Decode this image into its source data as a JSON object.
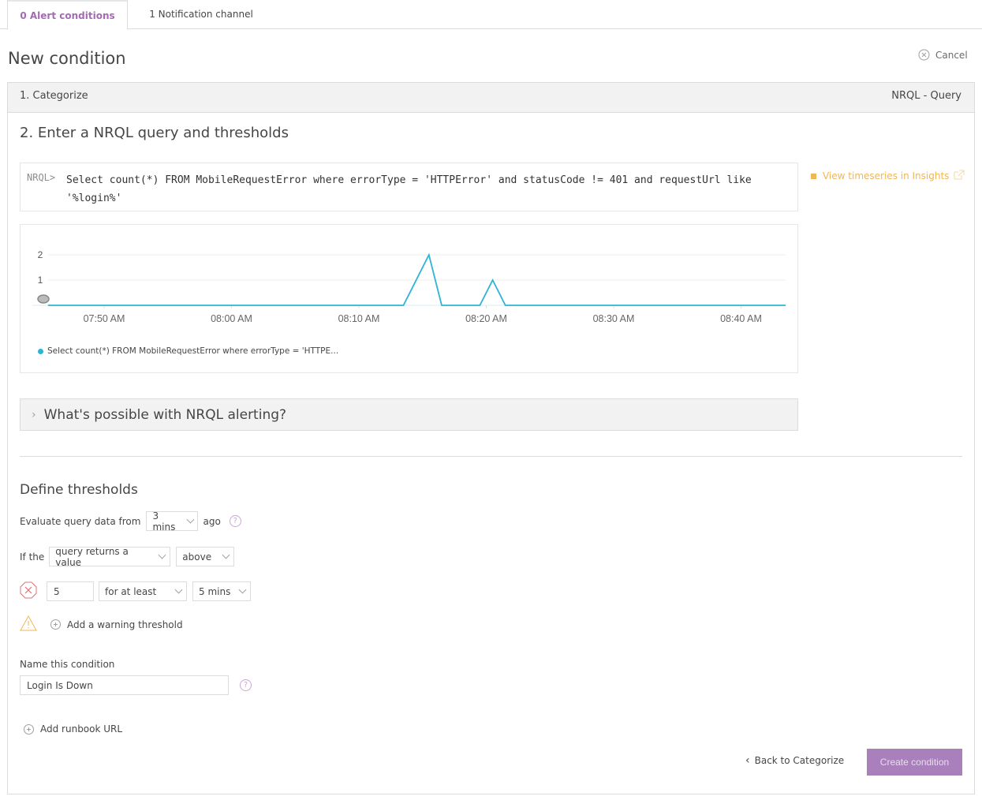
{
  "tabs": [
    {
      "label": "0 Alert conditions",
      "active": true
    },
    {
      "label": "1 Notification channel",
      "active": false
    }
  ],
  "page_title": "New condition",
  "cancel_label": "Cancel",
  "step1": {
    "label": "1. Categorize",
    "type": "NRQL - Query"
  },
  "step2": {
    "title": "2. Enter a NRQL query and thresholds",
    "prompt": "NRQL>",
    "query": "Select count(*) FROM MobileRequestError where errorType = 'HTTPError' and statusCode != 401 and requestUrl like\n'%login%'",
    "insights_link": "View timeseries in Insights"
  },
  "chart_data": {
    "type": "line",
    "title": "",
    "xlabel": "",
    "ylabel": "",
    "x_tick_labels": [
      "07:50 AM",
      "08:00 AM",
      "08:10 AM",
      "08:20 AM",
      "08:30 AM",
      "08:40 AM"
    ],
    "y_tick_labels": [
      "1",
      "2"
    ],
    "ylim": [
      0,
      2
    ],
    "xlim_minutes_from_0740": [
      5.6,
      63.5
    ],
    "grid": true,
    "legend_position": "bottom-left",
    "series": [
      {
        "name": "Select count(*) FROM MobileRequestError where errorType = 'HTTPE...",
        "color": "#2bb5d3",
        "x_minutes_from_0740": [
          5.6,
          33.5,
          35.5,
          36.5,
          39.5,
          40.5,
          41.5,
          63.5
        ],
        "values": [
          0,
          0,
          2,
          0,
          0,
          1,
          0,
          0
        ]
      }
    ]
  },
  "accordion_label": "What's possible with NRQL alerting?",
  "thresholds": {
    "title": "Define thresholds",
    "evaluate_label": "Evaluate query data from",
    "evaluate_value": "3 mins",
    "evaluate_suffix": "ago",
    "if_label": "If the",
    "condition_value": "query returns a value",
    "operator_value": "above",
    "critical_value": "5",
    "duration_mode": "for at least",
    "duration_value": "5 mins",
    "add_warning_label": "Add a warning threshold"
  },
  "name_section": {
    "label": "Name this condition",
    "value": "Login Is Down"
  },
  "runbook_label": "Add runbook URL",
  "footer": {
    "back_label": "Back to Categorize",
    "create_label": "Create condition"
  },
  "colors": {
    "accent": "#a46bb3",
    "button": "#a980bb",
    "link_orange": "#f0b656",
    "series": "#2bb5d3",
    "critical": "#e07070",
    "warning": "#f0b656"
  }
}
